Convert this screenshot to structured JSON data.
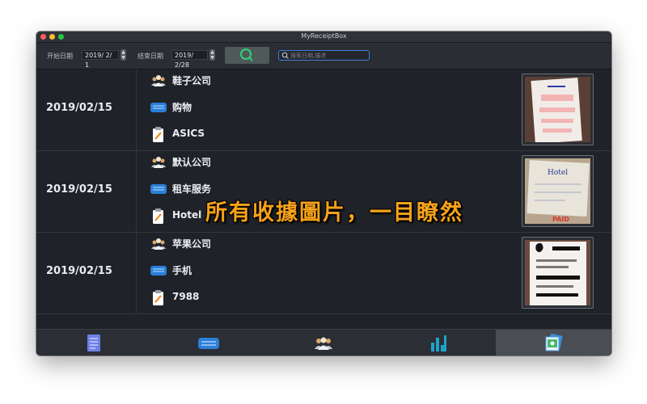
{
  "window": {
    "title": "MyReceiptBox"
  },
  "toolbar": {
    "start_label": "开始日期",
    "start_date": "2019/ 2/ 1",
    "end_label": "结束日期",
    "end_date": "2019/ 2/28",
    "search_placeholder": "搜索日期,描述"
  },
  "receipts": [
    {
      "date": "2019/02/15",
      "company": "鞋子公司",
      "category": "购物",
      "description": "ASICS"
    },
    {
      "date": "2019/02/15",
      "company": "默认公司",
      "category": "租车服务",
      "description": "Hotel"
    },
    {
      "date": "2019/02/15",
      "company": "苹果公司",
      "category": "手机",
      "description": "7988"
    }
  ],
  "overlay": {
    "caption": "所有收據圖片，一目瞭然"
  },
  "tabs": [
    {
      "icon": "receipt-list-icon"
    },
    {
      "icon": "category-icon"
    },
    {
      "icon": "company-people-icon"
    },
    {
      "icon": "bar-chart-icon"
    },
    {
      "icon": "photos-icon",
      "active": true
    }
  ],
  "colors": {
    "accent_search": "#3d7dd9",
    "overlay_text": "#f7a21a",
    "chart_icon": "#1fa3c8"
  }
}
